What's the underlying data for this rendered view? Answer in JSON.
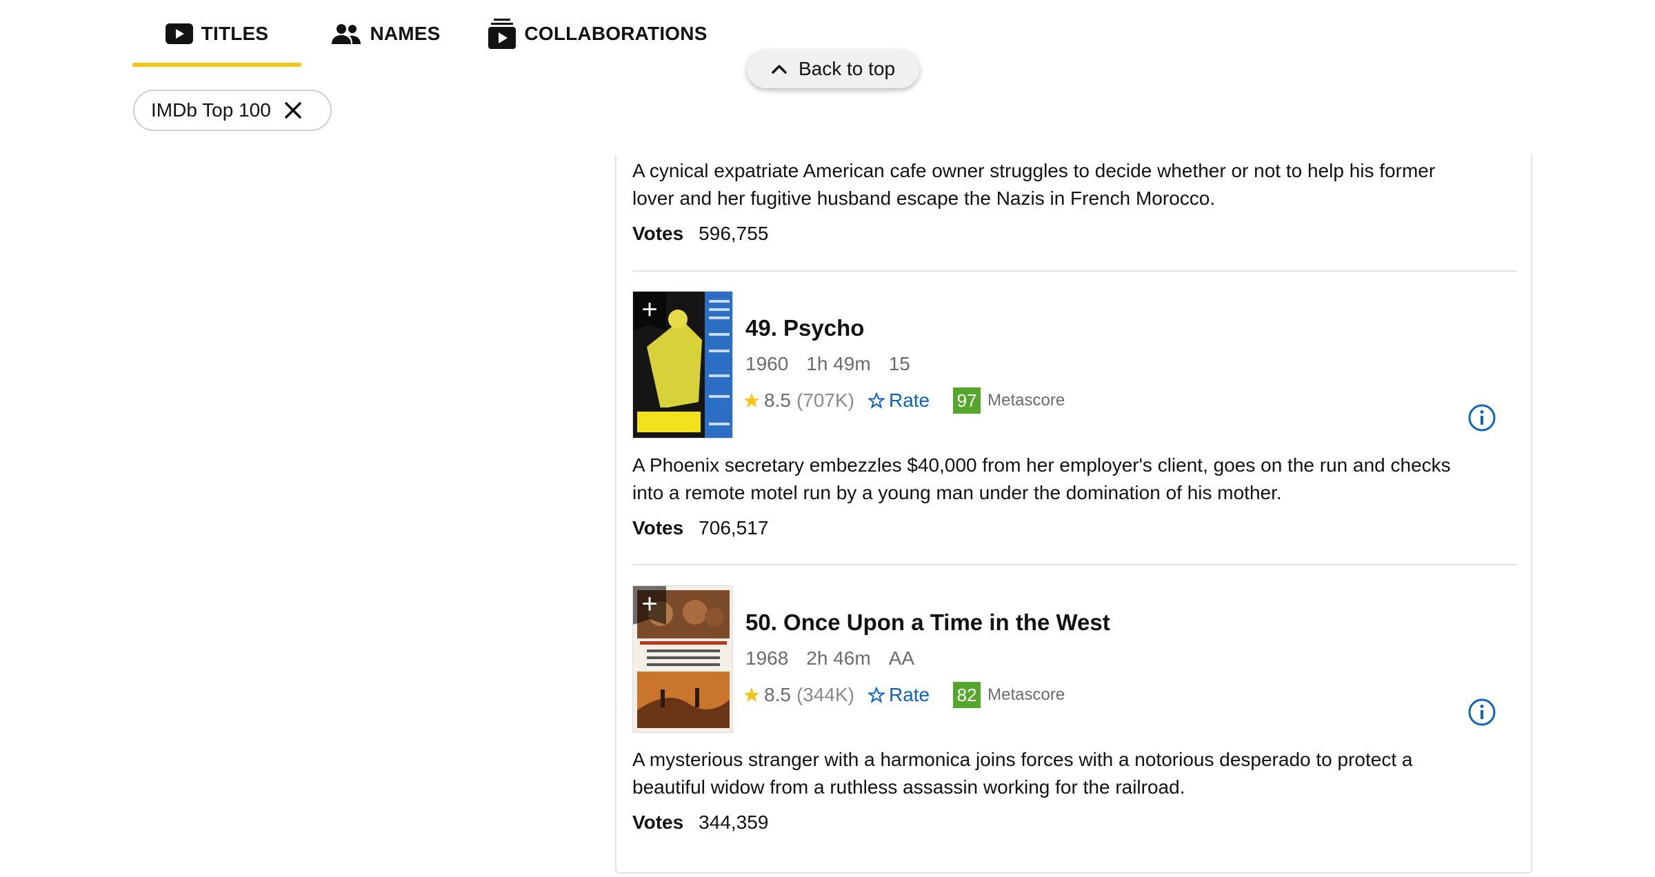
{
  "tabs": [
    {
      "label": "TITLES",
      "icon": "video-icon",
      "active": true
    },
    {
      "label": "NAMES",
      "icon": "people-icon",
      "active": false
    },
    {
      "label": "COLLABORATIONS",
      "icon": "collaborations-icon",
      "active": false
    }
  ],
  "filter_chip": {
    "label": "IMDb Top 100",
    "icon": "close-icon"
  },
  "back_to_top": {
    "label": "Back to top",
    "icon": "chevron-up-icon"
  },
  "colors": {
    "accent": "#f5c518",
    "link": "#0e63be",
    "metascore_good": "#54a72a"
  },
  "prev_item": {
    "plot": "A cynical expatriate American cafe owner struggles to decide whether or not to help his former lover and her fugitive husband escape the Nazis in French Morocco.",
    "votes_label": "Votes",
    "votes": "596,755"
  },
  "items": [
    {
      "title": "49. Psycho",
      "year": "1960",
      "runtime": "1h 49m",
      "certificate": "15",
      "rating": "8.5",
      "rating_count": "(707K)",
      "rate_label": "Rate",
      "metascore": "97",
      "metascore_label": "Metascore",
      "plot": "A Phoenix secretary embezzles $40,000 from her employer's client, goes on the run and checks into a remote motel run by a young man under the domination of his mother.",
      "votes_label": "Votes",
      "votes": "706,517",
      "poster_add": "+"
    },
    {
      "title": "50. Once Upon a Time in the West",
      "year": "1968",
      "runtime": "2h 46m",
      "certificate": "AA",
      "rating": "8.5",
      "rating_count": "(344K)",
      "rate_label": "Rate",
      "metascore": "82",
      "metascore_label": "Metascore",
      "plot": "A mysterious stranger with a harmonica joins forces with a notorious desperado to protect a beautiful widow from a ruthless assassin working for the railroad.",
      "votes_label": "Votes",
      "votes": "344,359",
      "poster_add": "+"
    }
  ]
}
